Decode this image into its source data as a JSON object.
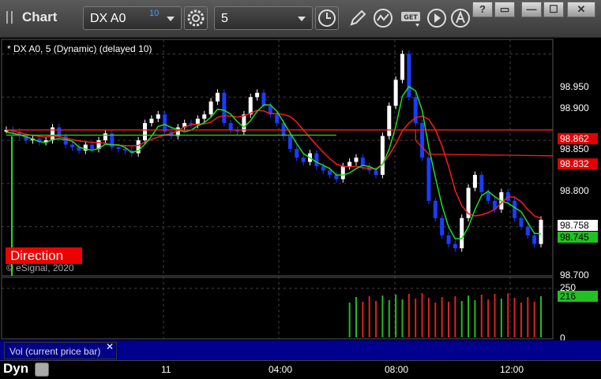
{
  "window": {
    "title": "Chart",
    "buttons": [
      "?",
      "▭",
      "—",
      "☐",
      "✕"
    ]
  },
  "toolbar": {
    "symbol": "DX A0",
    "delay": "10",
    "interval": "5"
  },
  "chart": {
    "legend": "* DX A0, 5 (Dynamic) (delayed 10)",
    "direction_label": "Direction",
    "copyright": "© eSignal, 2020",
    "price_axis": [
      "98.950",
      "98.900",
      "98.850",
      "98.800",
      "98.700"
    ],
    "price_markers": [
      {
        "value": "98.862",
        "bg": "#e00000",
        "fg": "#ffffff"
      },
      {
        "value": "98.832",
        "bg": "#e00000",
        "fg": "#ffffff"
      },
      {
        "value": "98.758",
        "bg": "#ffffff",
        "fg": "#000000"
      },
      {
        "value": "98.745",
        "bg": "#22c022",
        "fg": "#000000"
      }
    ],
    "volume_axis": [
      "250",
      "0"
    ],
    "volume_marker": "216",
    "volume_study": "Vol (current price bar)",
    "volume_close": "✕",
    "time_axis": [
      "11",
      "04:00",
      "08:00",
      "12:00"
    ],
    "mode": "Dyn"
  },
  "colors": {
    "up_candle": "#ffffff",
    "down_candle": "#1a3cff",
    "red_line": "#ff1a1a",
    "green_line": "#22dd22"
  },
  "chart_data": {
    "type": "line",
    "price_range": [
      98.695,
      98.965
    ],
    "close_series": [
      98.862,
      98.86,
      98.855,
      98.85,
      98.852,
      98.848,
      98.85,
      98.865,
      98.855,
      98.845,
      98.842,
      98.838,
      98.845,
      98.84,
      98.85,
      98.858,
      98.842,
      98.84,
      98.838,
      98.835,
      98.85,
      98.87,
      98.875,
      98.88,
      98.86,
      98.855,
      98.865,
      98.87,
      98.868,
      98.875,
      98.88,
      98.895,
      98.905,
      98.87,
      98.862,
      98.86,
      98.88,
      98.9,
      98.905,
      98.89,
      98.88,
      98.87,
      98.855,
      98.84,
      98.83,
      98.825,
      98.835,
      98.82,
      98.815,
      98.81,
      98.805,
      98.82,
      98.825,
      98.83,
      98.82,
      98.815,
      98.81,
      98.855,
      98.89,
      98.92,
      98.95,
      98.9,
      98.87,
      98.83,
      98.78,
      98.76,
      98.74,
      98.73,
      98.725,
      98.76,
      98.795,
      98.81,
      98.79,
      98.78,
      98.77,
      98.79,
      98.78,
      98.76,
      98.75,
      98.74,
      98.73,
      98.758
    ]
  }
}
